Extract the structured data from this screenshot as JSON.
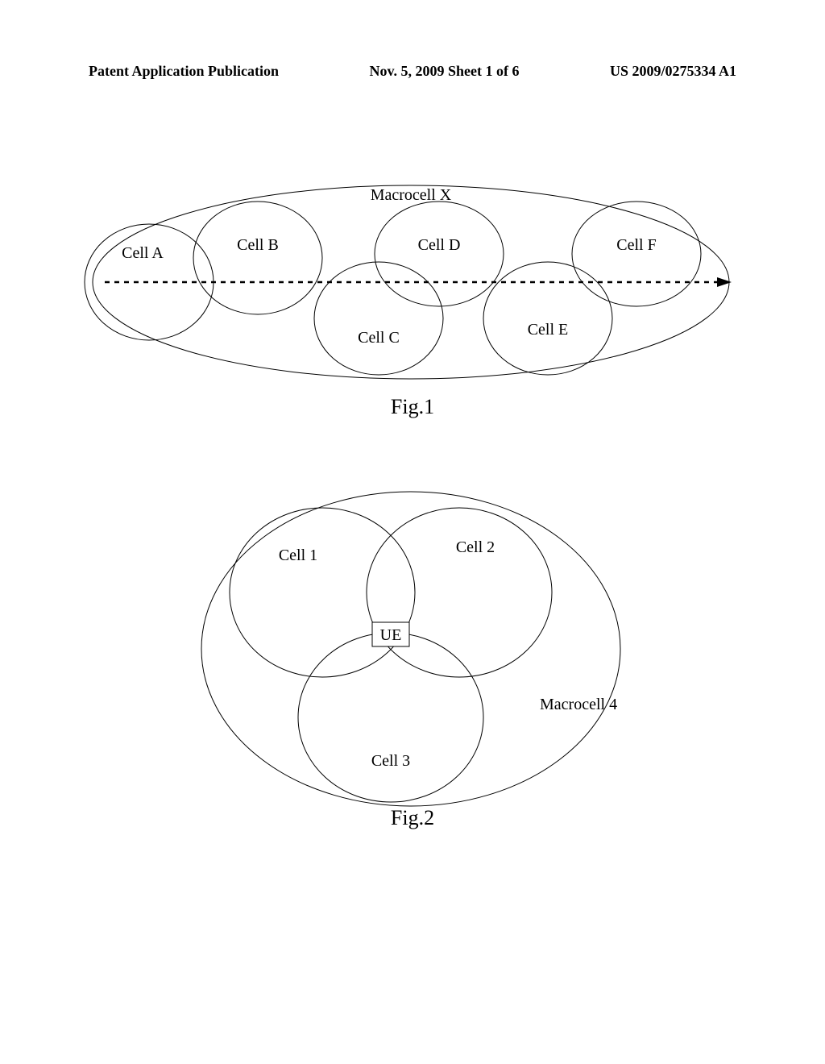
{
  "header": {
    "left": "Patent Application Publication",
    "mid": "Nov. 5, 2009  Sheet 1 of 6",
    "right": "US 2009/0275334 A1"
  },
  "fig1": {
    "caption": "Fig.1",
    "macrocell": "Macrocell X",
    "cells": {
      "A": "Cell A",
      "B": "Cell B",
      "C": "Cell C",
      "D": "Cell D",
      "E": "Cell E",
      "F": "Cell F"
    }
  },
  "fig2": {
    "caption": "Fig.2",
    "macrocell": "Macrocell 4",
    "ue": "UE",
    "cells": {
      "1": "Cell 1",
      "2": "Cell 2",
      "3": "Cell 3"
    }
  }
}
